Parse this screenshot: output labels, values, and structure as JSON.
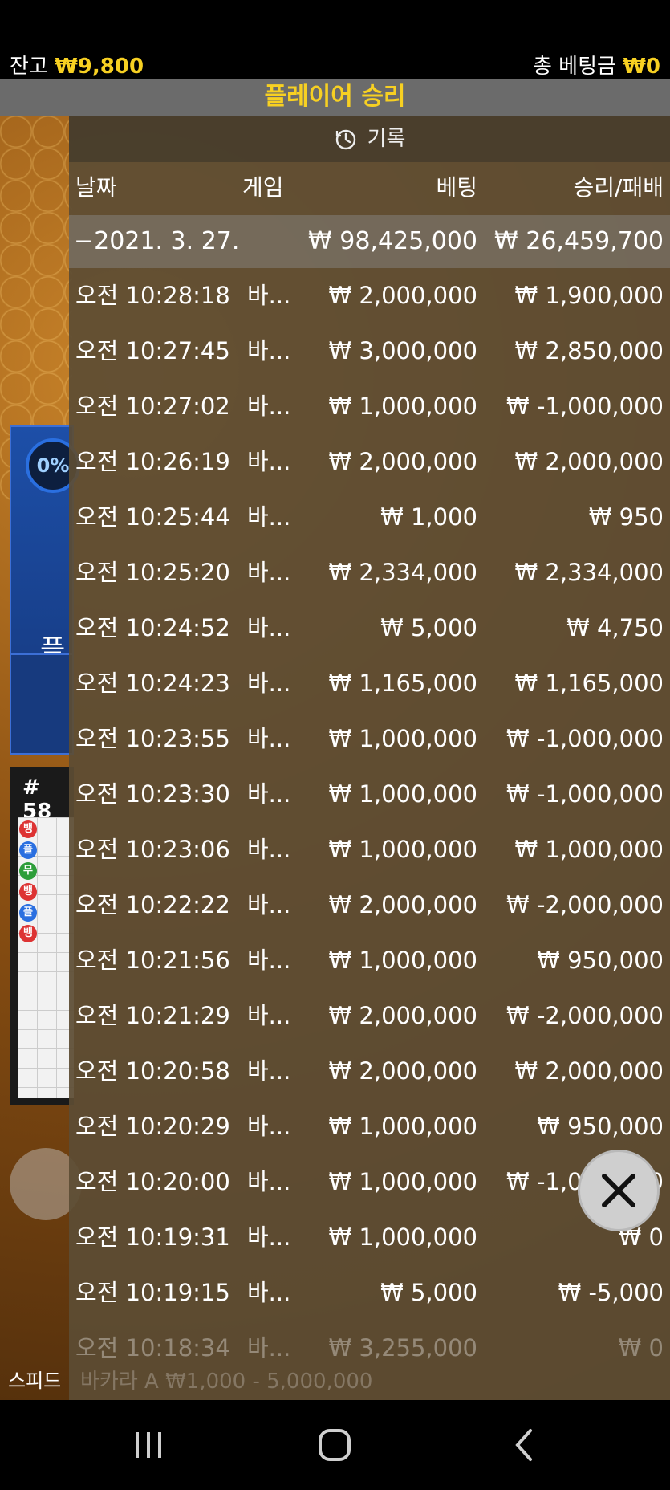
{
  "topbar": {
    "balance_label": "잔고",
    "balance_value": "₩9,800",
    "total_bet_label": "총 베팅금",
    "total_bet_value": "₩0"
  },
  "status_banner": "플레이어 승리",
  "background": {
    "percent": "0%",
    "panel_label": "플",
    "road_number": "# 58",
    "speed_label": "스피드"
  },
  "history": {
    "title": "기록",
    "columns": [
      "날짜",
      "게임",
      "베팅",
      "승리/패배"
    ],
    "day_summary": {
      "date": "−2021. 3. 27.",
      "bet": "₩ 98,425,000",
      "win_loss": "₩ 26,459,700"
    },
    "rows": [
      {
        "time": "오전 10:28:18",
        "game": "바...",
        "bet": "₩ 2,000,000",
        "win_loss": "₩ 1,900,000"
      },
      {
        "time": "오전 10:27:45",
        "game": "바...",
        "bet": "₩ 3,000,000",
        "win_loss": "₩ 2,850,000"
      },
      {
        "time": "오전 10:27:02",
        "game": "바...",
        "bet": "₩ 1,000,000",
        "win_loss": "₩ -1,000,000"
      },
      {
        "time": "오전 10:26:19",
        "game": "바...",
        "bet": "₩ 2,000,000",
        "win_loss": "₩ 2,000,000"
      },
      {
        "time": "오전 10:25:44",
        "game": "바...",
        "bet": "₩ 1,000",
        "win_loss": "₩ 950"
      },
      {
        "time": "오전 10:25:20",
        "game": "바...",
        "bet": "₩ 2,334,000",
        "win_loss": "₩ 2,334,000"
      },
      {
        "time": "오전 10:24:52",
        "game": "바...",
        "bet": "₩ 5,000",
        "win_loss": "₩ 4,750"
      },
      {
        "time": "오전 10:24:23",
        "game": "바...",
        "bet": "₩ 1,165,000",
        "win_loss": "₩ 1,165,000"
      },
      {
        "time": "오전 10:23:55",
        "game": "바...",
        "bet": "₩ 1,000,000",
        "win_loss": "₩ -1,000,000"
      },
      {
        "time": "오전 10:23:30",
        "game": "바...",
        "bet": "₩ 1,000,000",
        "win_loss": "₩ -1,000,000"
      },
      {
        "time": "오전 10:23:06",
        "game": "바...",
        "bet": "₩ 1,000,000",
        "win_loss": "₩ 1,000,000"
      },
      {
        "time": "오전 10:22:22",
        "game": "바...",
        "bet": "₩ 2,000,000",
        "win_loss": "₩ -2,000,000"
      },
      {
        "time": "오전 10:21:56",
        "game": "바...",
        "bet": "₩ 1,000,000",
        "win_loss": "₩ 950,000"
      },
      {
        "time": "오전 10:21:29",
        "game": "바...",
        "bet": "₩ 2,000,000",
        "win_loss": "₩ -2,000,000"
      },
      {
        "time": "오전 10:20:58",
        "game": "바...",
        "bet": "₩ 2,000,000",
        "win_loss": "₩ 2,000,000"
      },
      {
        "time": "오전 10:20:29",
        "game": "바...",
        "bet": "₩ 1,000,000",
        "win_loss": "₩ 950,000"
      },
      {
        "time": "오전 10:20:00",
        "game": "바...",
        "bet": "₩ 1,000,000",
        "win_loss": "₩ -1,000,000"
      },
      {
        "time": "오전 10:19:31",
        "game": "바...",
        "bet": "₩ 1,000,000",
        "win_loss": "₩ 0"
      },
      {
        "time": "오전 10:19:15",
        "game": "바...",
        "bet": "₩ 5,000",
        "win_loss": "₩ -5,000"
      },
      {
        "time": "오전 10:18:34",
        "game": "바...",
        "bet": "₩ 3,255,000",
        "win_loss": "₩ 0"
      }
    ],
    "footer_faded": "바카라 A ₩1,000 - 5,000,000"
  },
  "close_icon": "close-icon",
  "navbar": {
    "recent": "recent-apps-icon",
    "home": "home-icon",
    "back": "back-icon"
  },
  "colors": {
    "gold": "#f7d022",
    "banner": "#6b6b6b",
    "overlay": "#5c4c34"
  }
}
